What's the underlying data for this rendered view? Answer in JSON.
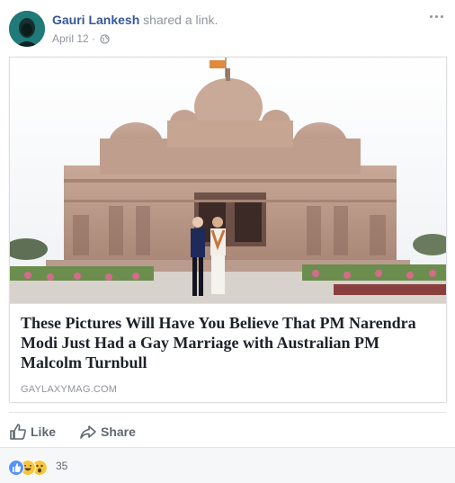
{
  "post": {
    "author": "Gauri Lankesh",
    "action_text": "shared a",
    "action_link": "link.",
    "date": "April 12",
    "separator": "·"
  },
  "link_card": {
    "title": "These Pictures Will Have You Believe That PM Narendra Modi Just Had a Gay Marriage with Australian PM Malcolm Turnbull",
    "domain": "GAYLAXYMAG.COM"
  },
  "actions": {
    "like_label": "Like",
    "share_label": "Share"
  },
  "reactions": {
    "count": "35",
    "types": [
      "like",
      "haha",
      "wow"
    ]
  },
  "colors": {
    "name_link": "#365899",
    "meta_text": "#90949c",
    "action_text": "#606770",
    "like_blue": "#5890ff",
    "haha_yellow": "#f7c63d"
  },
  "icons": [
    "globe-icon",
    "more-options-icon",
    "like-thumb-icon",
    "share-arrow-icon"
  ]
}
